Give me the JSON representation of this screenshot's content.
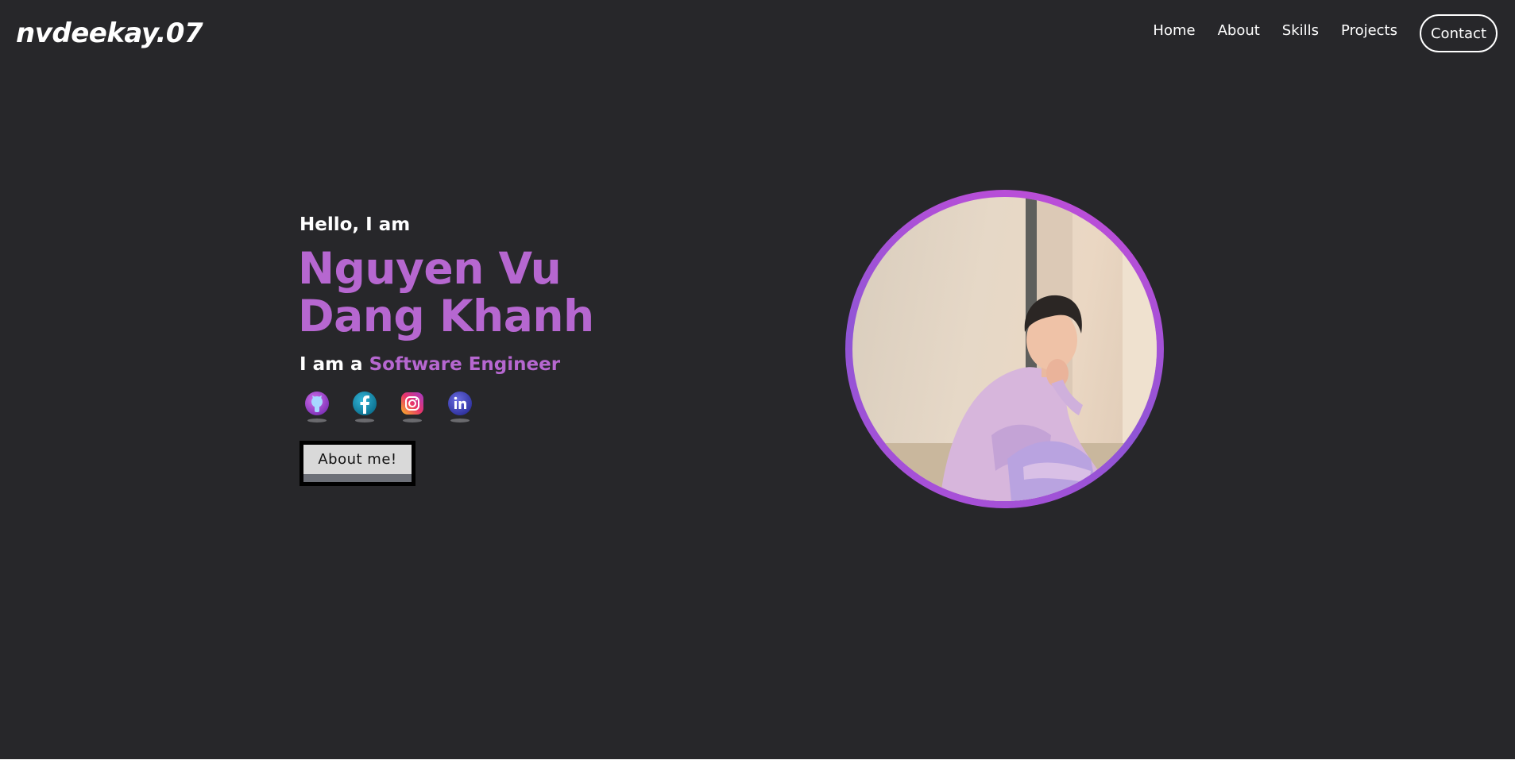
{
  "header": {
    "logo": "nvdeekay.07",
    "nav": [
      "Home",
      "About",
      "Skills",
      "Projects"
    ],
    "contact_label": "Contact"
  },
  "hero": {
    "greeting": "Hello, I am",
    "name_line1": "Nguyen Vu",
    "name_line2": "Dang Khanh",
    "role_prefix": "I am a",
    "role_title": "Software Engineer",
    "about_button": "About me!",
    "socials": [
      {
        "icon": "github-icon"
      },
      {
        "icon": "facebook-icon"
      },
      {
        "icon": "instagram-icon"
      },
      {
        "icon": "linkedin-icon"
      }
    ],
    "avatar_icon": "profile-photo"
  },
  "colors": {
    "background": "#27272a",
    "accent": "#b667d0",
    "text": "#ffffff"
  }
}
